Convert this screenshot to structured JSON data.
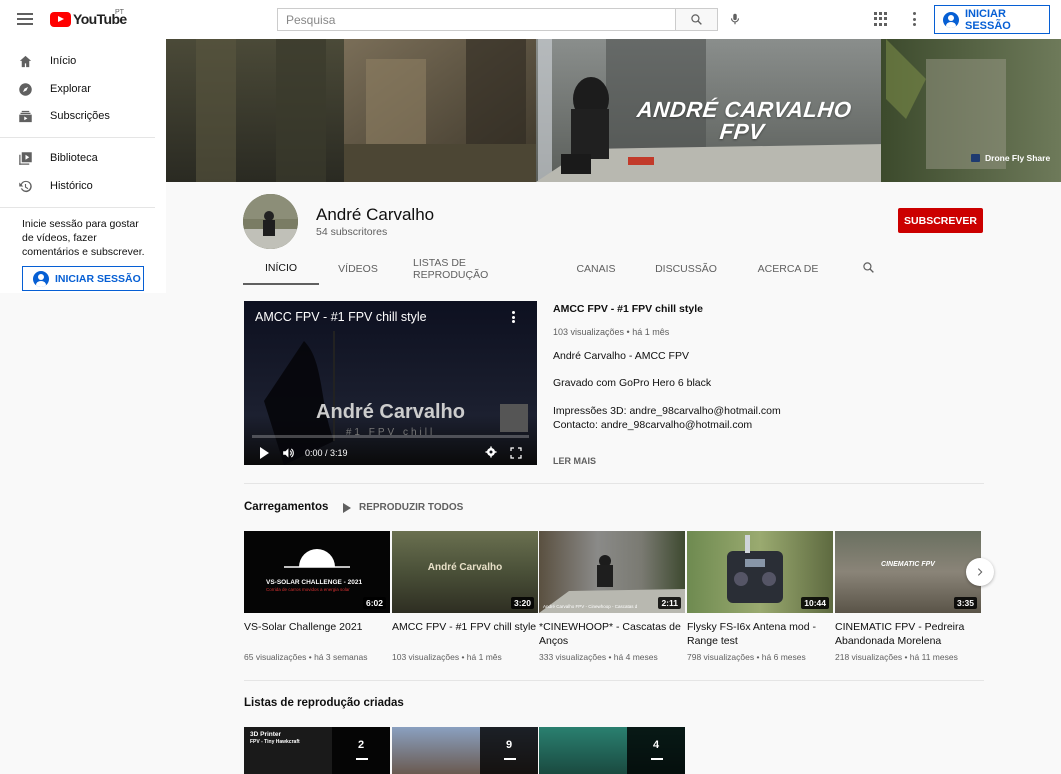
{
  "topbar": {
    "logo_text": "YouTube",
    "country": "PT",
    "search_placeholder": "Pesquisa",
    "signin_label": "INICIAR SESSÃO"
  },
  "sidebar": {
    "items": [
      {
        "label": "Início",
        "icon": "home-icon"
      },
      {
        "label": "Explorar",
        "icon": "compass-icon"
      },
      {
        "label": "Subscrições",
        "icon": "subscriptions-icon"
      },
      {
        "label": "Biblioteca",
        "icon": "library-icon"
      },
      {
        "label": "Histórico",
        "icon": "history-icon"
      }
    ],
    "message": "Inicie sessão para gostar de vídeos, fazer comentários e subscrever.",
    "signin_label": "INICIAR SESSÃO"
  },
  "banner": {
    "title_line1": "ANDRÉ CARVALHO",
    "title_line2": "FPV",
    "link_label": "Drone Fly Share"
  },
  "channel": {
    "name": "André Carvalho",
    "subscribers": "54 subscritores",
    "subscribe_label": "SUBSCREVER",
    "tabs": [
      "INÍCIO",
      "VÍDEOS",
      "LISTAS DE REPRODUÇÃO",
      "CANAIS",
      "DISCUSSÃO",
      "ACERCA DE"
    ]
  },
  "featured": {
    "player_title": "AMCC FPV - #1 FPV chill style",
    "overlay_title": "André Carvalho",
    "overlay_sub": "#1 FPV chill",
    "time": "0:00 / 3:19",
    "title": "AMCC FPV - #1 FPV chill style",
    "meta": "103 visualizações • há 1 mês",
    "line1": "André Carvalho - AMCC FPV",
    "line2": "Gravado com GoPro Hero 6 black",
    "line3": "Impressões 3D: andre_98carvalho@hotmail.com",
    "line4": "Contacto: andre_98carvalho@hotmail.com",
    "more_label": "LER MAIS"
  },
  "uploads": {
    "title": "Carregamentos",
    "play_all": "REPRODUZIR TODOS",
    "videos": [
      {
        "title": "VS-Solar Challenge 2021",
        "meta": "65 visualizações • há 3 semanas",
        "duration": "6:02",
        "thumb_text": "VS-SOLAR CHALLENGE - 2021",
        "thumb_sub": "Corrida de carros movidos a energia solar"
      },
      {
        "title": "AMCC FPV - #1 FPV chill style",
        "meta": "103 visualizações • há 1 mês",
        "duration": "3:20",
        "thumb_text": "André Carvalho"
      },
      {
        "title": "*CINEWHOOP* - Cascatas de Anços",
        "meta": "333 visualizações • há 4 meses",
        "duration": "2:11",
        "thumb_text": "André Carvalho FPV - Cinewhoop - Cascatas d"
      },
      {
        "title": "Flysky FS-I6x Antena mod - Range test",
        "meta": "798 visualizações • há 6 meses",
        "duration": "10:44"
      },
      {
        "title": "CINEMATIC FPV - Pedreira Abandonada Morelena",
        "meta": "218 visualizações • há 11 meses",
        "duration": "3:35",
        "thumb_text": "CINEMATIC FPV"
      }
    ]
  },
  "playlists": {
    "title": "Listas de reprodução criadas",
    "items": [
      {
        "count": "2",
        "thumb_text": "3D Printer",
        "thumb_sub": "FPV - Tiny Hawkcraft"
      },
      {
        "count": "9"
      },
      {
        "count": "4"
      }
    ]
  },
  "colors": {
    "brand_red": "#ff0000",
    "subscribe_red": "#cc0000",
    "link_blue": "#065fd4"
  }
}
